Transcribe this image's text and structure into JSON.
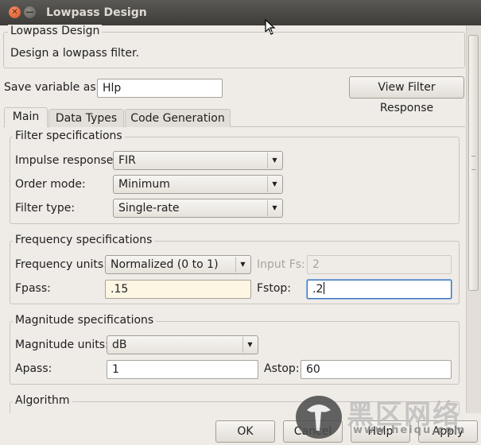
{
  "window": {
    "title": "Lowpass Design",
    "close_glyph": "✕",
    "minimize_glyph": "—"
  },
  "header_group": {
    "title": "Lowpass Design",
    "description": "Design a lowpass filter."
  },
  "save_variable": {
    "label": "Save variable as:",
    "value": "Hlp"
  },
  "view_filter_response_label": "View Filter Response",
  "tabs": [
    {
      "label": "Main",
      "active": true
    },
    {
      "label": "Data Types",
      "active": false
    },
    {
      "label": "Code Generation",
      "active": false
    }
  ],
  "filter_specifications": {
    "title": "Filter specifications",
    "impulse_response": {
      "label": "Impulse response:",
      "value": "FIR"
    },
    "order_mode": {
      "label": "Order mode:",
      "value": "Minimum"
    },
    "filter_type": {
      "label": "Filter type:",
      "value": "Single-rate"
    }
  },
  "frequency_specifications": {
    "title": "Frequency specifications",
    "frequency_units": {
      "label": "Frequency units:",
      "value": "Normalized (0 to 1)"
    },
    "input_fs": {
      "label": "Input Fs:",
      "value": "2"
    },
    "fpass": {
      "label": "Fpass:",
      "value": ".15"
    },
    "fstop": {
      "label": "Fstop:",
      "value": ".2"
    }
  },
  "magnitude_specifications": {
    "title": "Magnitude specifications",
    "magnitude_units": {
      "label": "Magnitude units:",
      "value": "dB"
    },
    "apass": {
      "label": "Apass:",
      "value": "1"
    },
    "astop": {
      "label": "Astop:",
      "value": "60"
    }
  },
  "algorithm": {
    "title": "Algorithm"
  },
  "buttons": {
    "ok": "OK",
    "cancel": "Cancel",
    "help": "Help",
    "apply": "Apply"
  },
  "watermark": {
    "text": "黑区网络",
    "subtext": "www.heiqu.com"
  },
  "icons": {
    "dropdown": "▼"
  }
}
